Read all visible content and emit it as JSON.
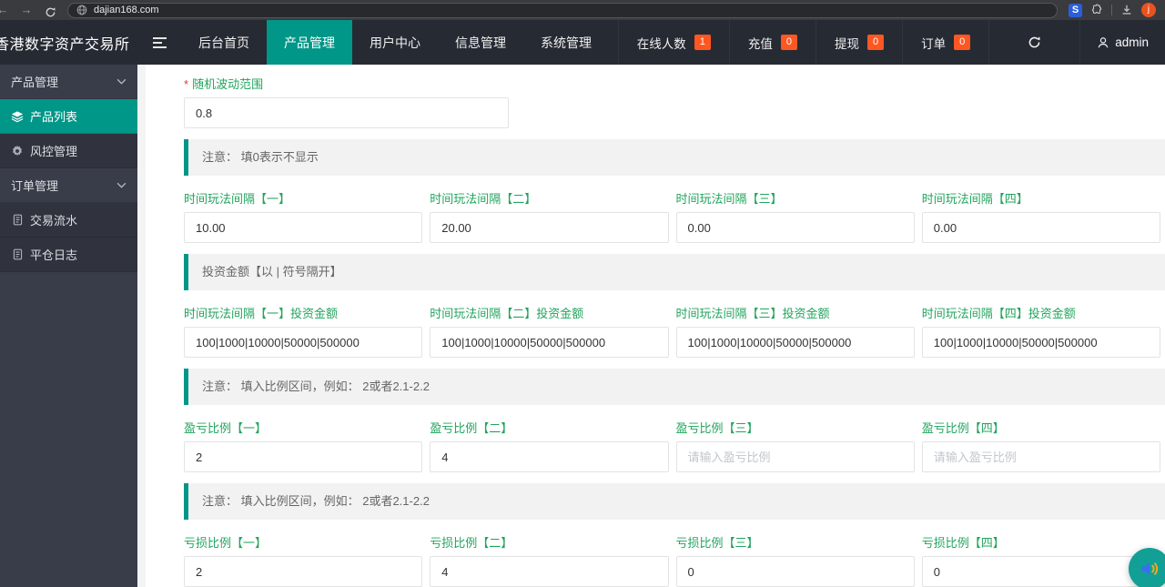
{
  "browser": {
    "url": "dajian168.com",
    "extension_label": "S",
    "avatar_initial": "j"
  },
  "header": {
    "logo": "香港数字资产交易所",
    "nav": [
      {
        "label": "后台首页"
      },
      {
        "label": "产品管理",
        "active": true
      },
      {
        "label": "用户中心"
      },
      {
        "label": "信息管理"
      },
      {
        "label": "系统管理"
      }
    ],
    "status": [
      {
        "label": "在线人数",
        "count": "1"
      },
      {
        "label": "充值",
        "count": "0"
      },
      {
        "label": "提现",
        "count": "0"
      },
      {
        "label": "订单",
        "count": "0"
      }
    ],
    "username": "admin"
  },
  "sidebar": {
    "items": [
      {
        "label": "产品管理",
        "type": "group"
      },
      {
        "label": "产品列表",
        "type": "item",
        "active": true
      },
      {
        "label": "风控管理",
        "type": "item"
      },
      {
        "label": "订单管理",
        "type": "group"
      },
      {
        "label": "交易流水",
        "type": "item"
      },
      {
        "label": "平仓日志",
        "type": "item"
      }
    ]
  },
  "form": {
    "required_mark": "*",
    "volatility": {
      "label": "随机波动范围",
      "value": "0.8"
    },
    "note_display": "注意： 填0表示不显示",
    "note_invest": "投资金额【以 | 符号隔开】",
    "note_ratio": "注意： 填入比例区间，例如： 2或者2.1-2.2",
    "interval_row": {
      "fields": [
        {
          "label": "时间玩法间隔【一】",
          "value": "10.00"
        },
        {
          "label": "时间玩法间隔【二】",
          "value": "20.00"
        },
        {
          "label": "时间玩法间隔【三】",
          "value": "0.00"
        },
        {
          "label": "时间玩法间隔【四】",
          "value": "0.00"
        }
      ]
    },
    "invest_row": {
      "fields": [
        {
          "label": "时间玩法间隔【一】投资金额",
          "value": "100|1000|10000|50000|500000"
        },
        {
          "label": "时间玩法间隔【二】投资金额",
          "value": "100|1000|10000|50000|500000"
        },
        {
          "label": "时间玩法间隔【三】投资金额",
          "value": "100|1000|10000|50000|500000"
        },
        {
          "label": "时间玩法间隔【四】投资金额",
          "value": "100|1000|10000|50000|500000"
        }
      ]
    },
    "profit_row": {
      "fields": [
        {
          "label": "盈亏比例【一】",
          "value": "2",
          "placeholder": ""
        },
        {
          "label": "盈亏比例【二】",
          "value": "4",
          "placeholder": ""
        },
        {
          "label": "盈亏比例【三】",
          "value": "",
          "placeholder": "请输入盈亏比例"
        },
        {
          "label": "盈亏比例【四】",
          "value": "",
          "placeholder": "请输入盈亏比例"
        }
      ]
    },
    "loss_row": {
      "fields": [
        {
          "label": "亏损比例【一】",
          "value": "2"
        },
        {
          "label": "亏损比例【二】",
          "value": "4"
        },
        {
          "label": "亏损比例【三】",
          "value": "0"
        },
        {
          "label": "亏损比例【四】",
          "value": "0"
        }
      ]
    }
  },
  "colors": {
    "accent_teal": "#009688",
    "label_green": "#21a45d",
    "badge_orange": "#ff5722",
    "sidebar_dark": "#393d49",
    "header_dark": "#262a33"
  }
}
